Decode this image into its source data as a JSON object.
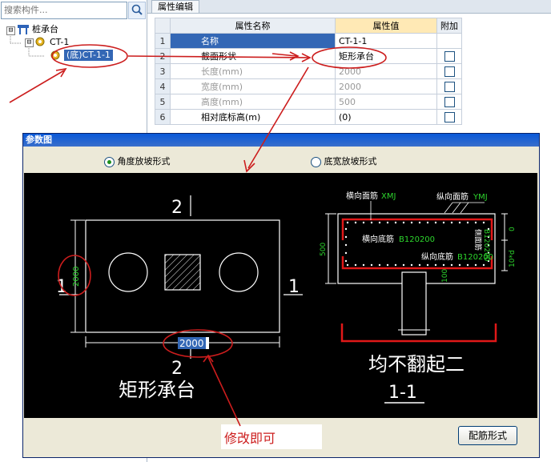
{
  "search": {
    "placeholder": "搜索构件..."
  },
  "tree": {
    "root_label": "桩承台",
    "toggle_expanded": "⊟",
    "child_label": "CT-1",
    "grandchild_label": "(底)CT-1-1"
  },
  "props_panel": {
    "tab_label": "属性编辑",
    "columns": {
      "name": "属性名称",
      "value": "属性值",
      "extra": "附加"
    },
    "rows": [
      {
        "num": "1",
        "name": "名称",
        "value": "CT-1-1",
        "has_check": false
      },
      {
        "num": "2",
        "name": "截面形状",
        "value": "矩形承台",
        "has_check": true
      },
      {
        "num": "3",
        "name": "长度(mm)",
        "value": "2000",
        "has_check": true
      },
      {
        "num": "4",
        "name": "宽度(mm)",
        "value": "2000",
        "has_check": true
      },
      {
        "num": "5",
        "name": "高度(mm)",
        "value": "500",
        "has_check": true
      },
      {
        "num": "6",
        "name": "相对底标高(m)",
        "value": "(0)",
        "has_check": true
      }
    ]
  },
  "dialog": {
    "title": "参数图",
    "radio_angle": "角度放坡形式",
    "radio_width": "底宽放坡形式",
    "rebar_button": "配筋形式"
  },
  "drawing": {
    "section_mark_top": "2",
    "section_mark_bottom": "2",
    "section_mark_left": "1",
    "section_mark_right": "1",
    "dim_left": "2000",
    "dim_bottom": "2000",
    "plan_caption": "矩形承台",
    "label_transverse_top": "横向面筋",
    "label_transverse_top_code": "XMJ",
    "label_longitudinal_top": "纵向面筋",
    "label_longitudinal_top_code": "YMJ",
    "label_transverse_bottom": "横向底筋",
    "label_transverse_bottom_code": "B120200",
    "label_longitudinal_bottom": "纵向底筋",
    "label_longitudinal_bottom_code": "B120200",
    "label_side_rebar": "侧面筋",
    "label_side_rebar_code": "B120200",
    "dim_height": "500",
    "dim_zero": "0",
    "dim_10d": "10*d",
    "dim_100": "100",
    "section_note": "均不翻起二",
    "section_title": "1-1"
  },
  "annotation": {
    "note": "修改即可"
  },
  "colors": {
    "annotation_red": "#cc1d1d",
    "rebar_red": "#e01818",
    "dim_green": "#2dd52d",
    "selection_blue": "#3367b5",
    "title_blue": "#0a58d8"
  }
}
